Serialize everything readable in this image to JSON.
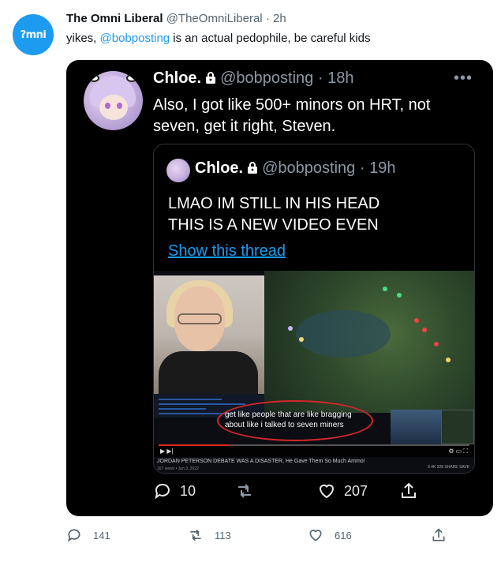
{
  "outer_tweet": {
    "avatar_text": "?mni",
    "name": "The Omni Liberal",
    "handle": "@TheOmniLiberal",
    "time": "2h",
    "text_before": "yikes, ",
    "mention": "@bobposting",
    "text_after": " is an actual pedophile, be careful kids",
    "replies": "141",
    "retweets": "113",
    "likes": "616"
  },
  "screenshot": {
    "name": "Chloe.",
    "handle": "@bobposting",
    "time": "18h",
    "text": "Also, I got like 500+ minors on HRT, not seven, get it right, Steven.",
    "replies": "10",
    "likes": "207",
    "quote": {
      "name": "Chloe.",
      "handle": "@bobposting",
      "time": "19h",
      "line1": "LMAO IM STILL IN HIS HEAD",
      "line2": "THIS IS A NEW VIDEO EVEN",
      "link": "Show this thread",
      "video": {
        "subtitle_line1": "get like people that are like bragging",
        "subtitle_line2": "about like i talked to seven miners",
        "title": "JORDAN PETERSON DEBATE WAS A DISASTER, He Gave Them So Much Ammo!",
        "meta": "167 views • Jun 3, 2022",
        "stats": "3.4K   328   SHARE   SAVE"
      }
    }
  },
  "icons": {
    "reply": "reply-icon",
    "retweet": "retweet-icon",
    "like": "heart-icon",
    "share": "share-icon",
    "more": "more-icon",
    "lock": "lock-icon"
  },
  "colors": {
    "accent": "#1d9bf0",
    "muted": "#536471",
    "dark_bg": "#000000",
    "highlight": "#d3272b"
  }
}
